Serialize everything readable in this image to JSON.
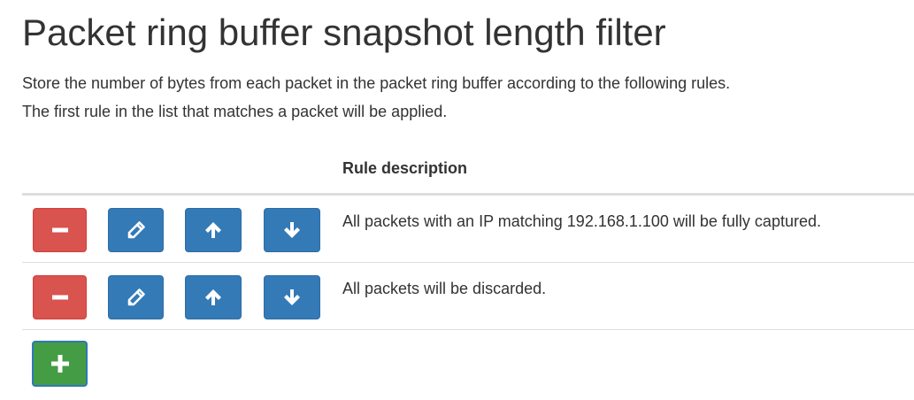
{
  "page": {
    "title": "Packet ring buffer snapshot length filter",
    "intro_line1": "Store the number of bytes from each packet in the packet ring buffer according to the following rules.",
    "intro_line2": "The first rule in the list that matches a packet will be applied."
  },
  "table": {
    "header_description": "Rule description",
    "rules": [
      {
        "description": "All packets with an IP matching 192.168.1.100 will be fully captured."
      },
      {
        "description": "All packets will be discarded."
      }
    ]
  },
  "icons": {
    "remove": "minus-icon",
    "edit": "pencil-icon",
    "move_up": "arrow-up-icon",
    "move_down": "arrow-down-icon",
    "add": "plus-icon"
  },
  "colors": {
    "danger": "#d9534f",
    "primary": "#337ab7",
    "success": "#449d44",
    "text": "#333333",
    "divider": "#dddddd"
  }
}
